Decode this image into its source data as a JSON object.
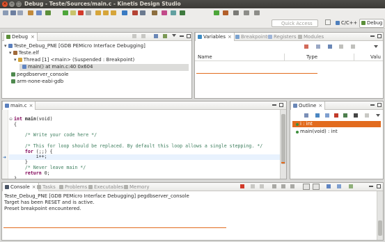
{
  "window": {
    "title": "Debug - Teste/Sources/main.c - Kinetis Design Studio"
  },
  "toolbar": {
    "quick_access_placeholder": "Quick Access",
    "perspective_c": "C/C++",
    "perspective_debug": "Debug"
  },
  "debug_view": {
    "tab": "Debug",
    "tree": [
      {
        "label": "Teste_Debug_PNE [GDB PEMicro Interface Debugging]",
        "icon": "launch-icon"
      },
      {
        "label": "Teste.elf",
        "icon": "elf-icon"
      },
      {
        "label": "Thread [1] <main> (Suspended : Breakpoint)",
        "icon": "thread-icon"
      },
      {
        "label": "main() at main.c:40 0x604",
        "icon": "stack-frame-icon"
      },
      {
        "label": "pegdbserver_console",
        "icon": "console-process-icon"
      },
      {
        "label": "arm-none-eabi-gdb",
        "icon": "gdb-process-icon"
      }
    ]
  },
  "variables_view": {
    "tabs": [
      "Variables",
      "Breakpoints",
      "Registers",
      "Modules"
    ],
    "columns": [
      "Name",
      "Type",
      "Valu"
    ]
  },
  "editor": {
    "tab": "main.c",
    "lines": [
      {
        "kind": "sig",
        "kw": "int",
        "fn": "main",
        "rest": "(void)"
      },
      {
        "kind": "plain",
        "text": "{"
      },
      {
        "kind": "blank",
        "text": ""
      },
      {
        "kind": "comment",
        "text": "    /* Write your code here */"
      },
      {
        "kind": "blank",
        "text": ""
      },
      {
        "kind": "comment",
        "text": "    /* This for loop should be replaced. By default this loop allows a single stepping. */"
      },
      {
        "kind": "for",
        "kw": "for",
        "rest": " (;;) {"
      },
      {
        "kind": "current",
        "text": "        i++;"
      },
      {
        "kind": "plain",
        "text": "    }"
      },
      {
        "kind": "comment",
        "text": "    /* Never leave main */"
      },
      {
        "kind": "return",
        "kw": "return",
        "rest": " 0;"
      },
      {
        "kind": "plain",
        "text": "}"
      }
    ]
  },
  "outline_view": {
    "tab": "Outline",
    "items": [
      {
        "label": "i : int",
        "icon": "variable-icon"
      },
      {
        "label": "main(void) : int",
        "icon": "function-icon"
      }
    ]
  },
  "console_view": {
    "tabs": [
      "Console",
      "Tasks",
      "Problems",
      "Executables",
      "Memory"
    ],
    "header": "Teste_Debug_PNE [GDB PEMicro Interface Debugging] pegdbserver_console",
    "lines": [
      "Target has been RESET and is active.",
      "Preset breakpoint encountered."
    ]
  }
}
